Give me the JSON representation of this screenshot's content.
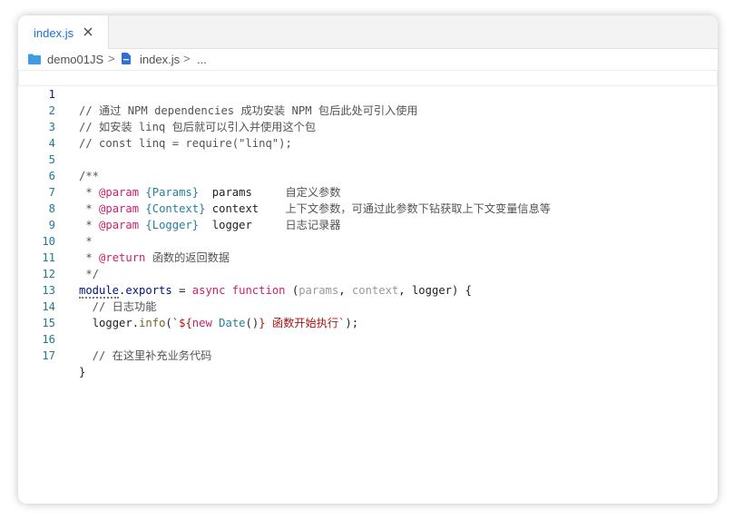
{
  "tab": {
    "label": "index.js"
  },
  "breadcrumb": {
    "folder": "demo01JS",
    "sep": ">",
    "file": "index.js",
    "more": "..."
  },
  "code": {
    "line_numbers": [
      "1",
      "2",
      "3",
      "4",
      "5",
      "6",
      "7",
      "8",
      "9",
      "10",
      "11",
      "12",
      "13",
      "14",
      "15",
      "16",
      "17"
    ],
    "l1": "// 通过 NPM dependencies 成功安装 NPM 包后此处可引入使用",
    "l2": "// 如安装 linq 包后就可以引入并使用这个包",
    "l3": "// const linq = require(\"linq\");",
    "l5": "/**",
    "l6": {
      "star": " * ",
      "tag": "@param",
      "type": "{Params}",
      "name": "  params",
      "desc": "     自定义参数"
    },
    "l7": {
      "star": " * ",
      "tag": "@param",
      "type": "{Context}",
      "name": " context",
      "desc": "    上下文参数，可通过此参数下钻获取上下文变量信息等"
    },
    "l8": {
      "star": " * ",
      "tag": "@param",
      "type": "{Logger}",
      "name": "  logger",
      "desc": "     日志记录器"
    },
    "l9": " *",
    "l10": {
      "star": " * ",
      "tag": "@return",
      "desc": " 函数的返回数据"
    },
    "l11": " */",
    "l12": {
      "module": "module",
      "dot": ".",
      "exports": "exports",
      "eq": " = ",
      "async": "async",
      "sp": " ",
      "function": "function",
      "open": " (",
      "p1": "params",
      "c1": ", ",
      "p2": "context",
      "c2": ", ",
      "p3": "logger",
      "close": ") {"
    },
    "l13": "  // 日志功能",
    "l14": {
      "indent": "  ",
      "obj": "logger",
      "dot": ".",
      "method": "info",
      "open": "(`",
      "interp_open": "${",
      "new": "new",
      "sp": " ",
      "date": "Date",
      "call": "()",
      "interp_close": "}",
      "text": " 函数开始执行",
      "close_str": "`",
      "end": ");"
    },
    "l16": "  // 在这里补充业务代码",
    "l17": "}"
  }
}
